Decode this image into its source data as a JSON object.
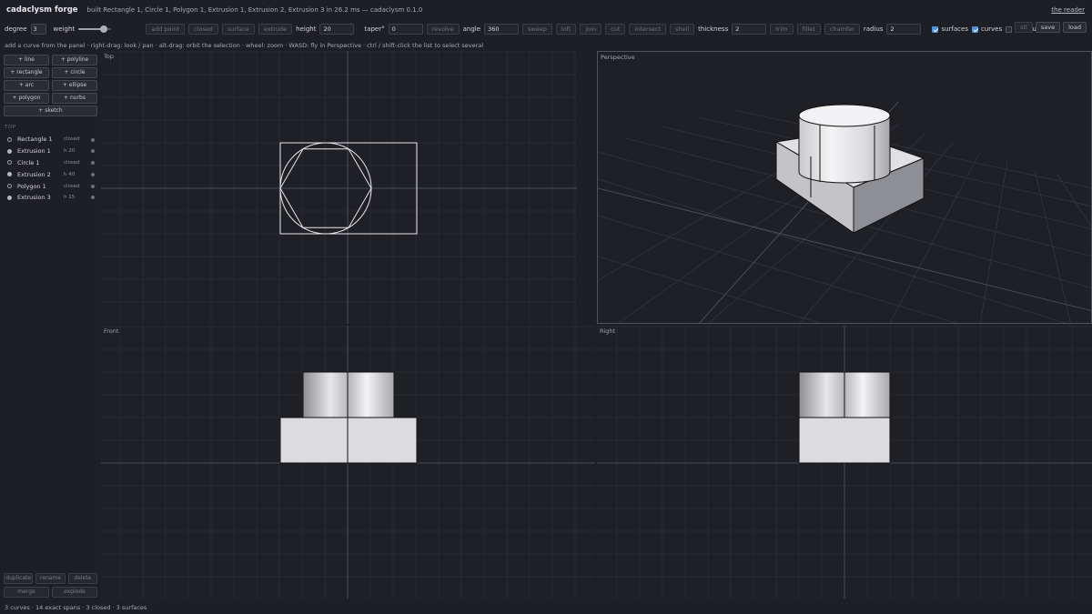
{
  "header": {
    "app_title": "cadaclysm forge",
    "build_message": "built Rectangle 1, Circle 1, Polygon 1, Extrusion 1, Extrusion 2, Extrusion 3 in 26.2 ms — cadaclysm 0.1.0",
    "reader_link": "the reader"
  },
  "toolbar": {
    "degree_label": "degree",
    "degree_value": "3",
    "weight_label": "weight",
    "weight_fraction": 0.78,
    "buttons": [
      "add point",
      "closed",
      "surface",
      "extrude"
    ],
    "height_label": "height",
    "height_value": "20",
    "taper_label": "taper°",
    "taper_value": "0",
    "revolve": "revolve",
    "angle_label": "angle",
    "angle_value": "360",
    "ops": [
      "sweep",
      "loft",
      "join",
      "cut",
      "intersect",
      "shell"
    ],
    "thickness_label": "thickness",
    "thickness_value": "2",
    "ops2": [
      "trim",
      "fillet",
      "chamfer"
    ],
    "radius_label": "radius",
    "radius_value": "2",
    "surfaces_label": "surfaces",
    "surfaces_checked": true,
    "curves_label": "curves",
    "curves_checked": true,
    "measures_label": "measures",
    "measures_checked": false,
    "stl": "stl",
    "save": "save",
    "load": "load",
    "accent_color": "#4d8fd6"
  },
  "hint": "add a curve from the panel · right-drag: look / pan · alt-drag: orbit the selection · wheel: zoom · WASD: fly in Perspective · ctrl / shift-click the list to select several",
  "panel": {
    "curve_buttons": [
      "+ line",
      "+ polyline",
      "+ rectangle",
      "+ circle",
      "+ arc",
      "+ ellipse",
      "+ polygon",
      "+ nurbs"
    ],
    "sketch_button": "+ sketch",
    "tree_heading": "TOP",
    "tree": [
      {
        "name": "Rectangle 1",
        "meta": "closed",
        "icon": "hollow"
      },
      {
        "name": "Extrusion 1",
        "meta": "h 20",
        "icon": "filled"
      },
      {
        "name": "Circle 1",
        "meta": "closed",
        "icon": "hollow"
      },
      {
        "name": "Extrusion 2",
        "meta": "h 40",
        "icon": "filled"
      },
      {
        "name": "Polygon 1",
        "meta": "closed",
        "icon": "hollow"
      },
      {
        "name": "Extrusion 3",
        "meta": "h 15",
        "icon": "filled"
      }
    ],
    "bottom_row1": [
      "duplicate",
      "rename",
      "delete"
    ],
    "bottom_row2": [
      "merge",
      "explode"
    ]
  },
  "viewports": {
    "top": "Top",
    "perspective": "Perspective",
    "front": "Front",
    "right": "Right"
  },
  "status": "3 curves · 14 exact spans · 3 closed · 3 surfaces"
}
